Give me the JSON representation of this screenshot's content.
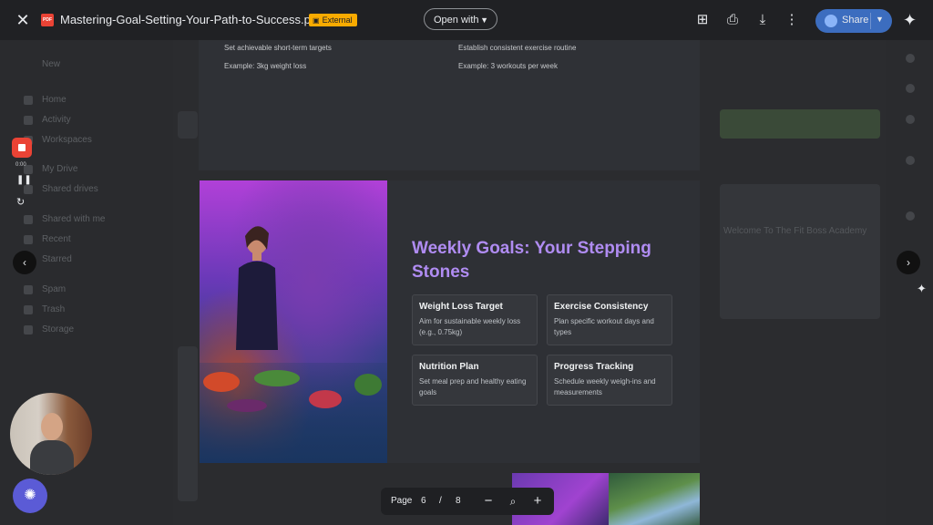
{
  "topbar": {
    "filename": "Mastering-Goal-Setting-Your-Path-to-Success.pdf",
    "external_badge": "External",
    "open_with": "Open with",
    "share": "Share"
  },
  "icons": {
    "close": "close-icon",
    "pdf": "pdf-file-icon",
    "comment": "add-comment-icon",
    "print": "print-icon",
    "download": "download-icon",
    "more": "more-vert-icon",
    "gemini": "gemini-sparkle-icon"
  },
  "prev_page": {
    "left_line1": "Set achievable short-term targets",
    "left_line2": "Example: 3kg weight loss",
    "right_line1": "Establish consistent exercise routine",
    "right_line2": "Example: 3 workouts per week"
  },
  "slide": {
    "title": "Weekly Goals: Your Stepping Stones",
    "cards": [
      {
        "title": "Weight Loss Target",
        "body": "Aim for sustainable weekly loss (e.g., 0.75kg)"
      },
      {
        "title": "Exercise Consistency",
        "body": "Plan specific workout days and types"
      },
      {
        "title": "Nutrition Plan",
        "body": "Set meal prep and healthy eating goals"
      },
      {
        "title": "Progress Tracking",
        "body": "Schedule weekly weigh-ins and measurements"
      }
    ]
  },
  "pager": {
    "label": "Page",
    "current": "6",
    "separator": "/",
    "total": "8"
  },
  "recorder": {
    "time": "0:00"
  },
  "background": {
    "new_label": "New",
    "sidebar_items": [
      "Home",
      "Activity",
      "Workspaces",
      "My Drive",
      "Shared drives",
      "Shared with me",
      "Recent",
      "Starred",
      "Spam",
      "Trash",
      "Storage"
    ],
    "card_title": "Welcome To The Fit Boss Academy"
  }
}
